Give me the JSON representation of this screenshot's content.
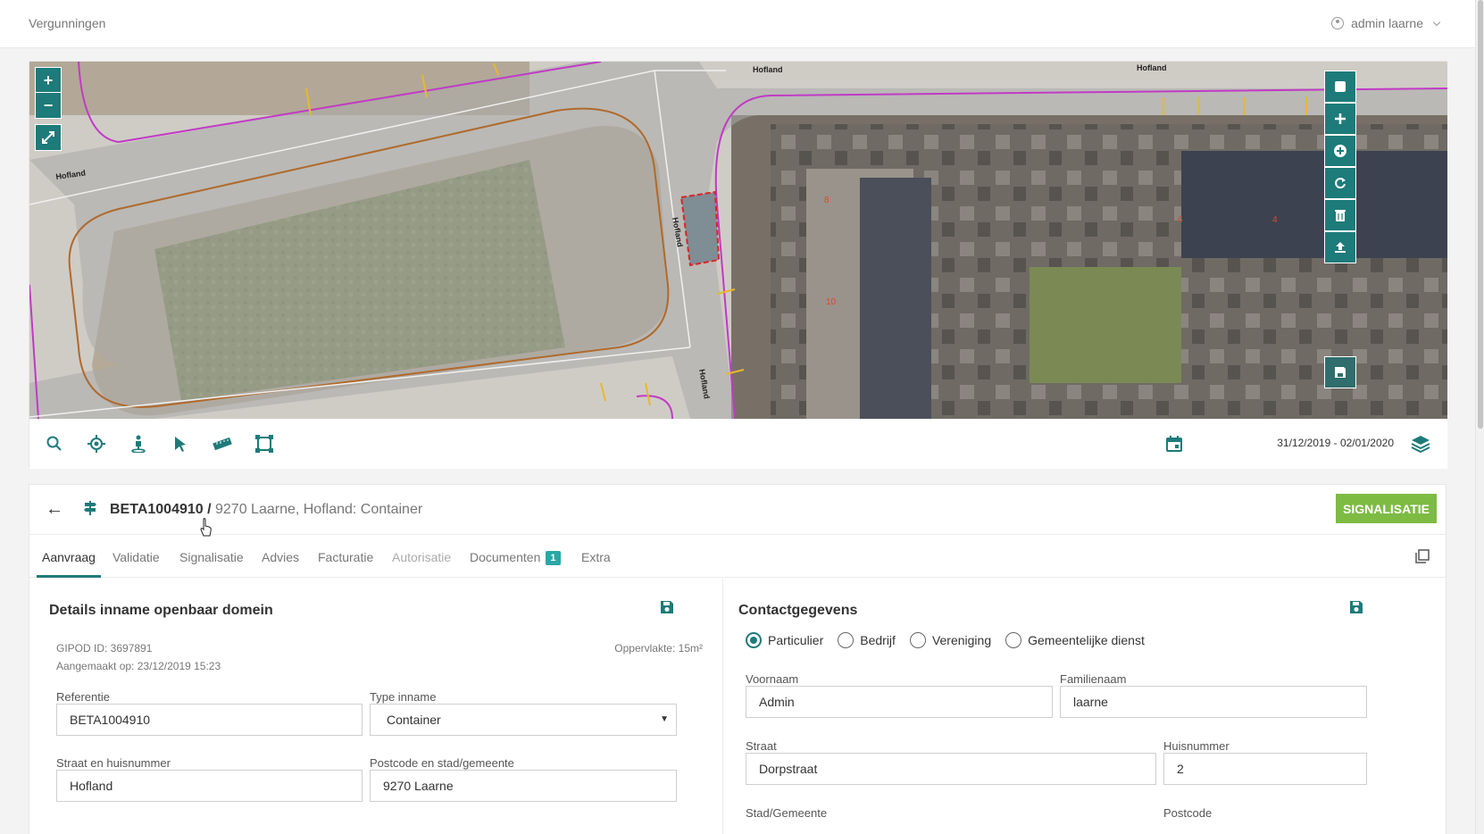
{
  "header": {
    "app_title": "Vergunningen",
    "user_name": "admin laarne"
  },
  "map": {
    "street_labels": [
      "Hofland",
      "Hofland",
      "Hofland",
      "Hofland",
      "Hofland"
    ],
    "house_numbers": [
      "8",
      "10",
      "6",
      "4"
    ],
    "zoom_in": "+",
    "zoom_out": "−",
    "date_range": "31/12/2019 - 02/01/2020"
  },
  "case": {
    "id": "BETA1004910",
    "separator": " / ",
    "address": "9270 Laarne, Hofland: Container",
    "signalisatie_button": "SIGNALISATIE"
  },
  "tabs": [
    {
      "label": "Aanvraag"
    },
    {
      "label": "Validatie"
    },
    {
      "label": "Signalisatie"
    },
    {
      "label": "Advies"
    },
    {
      "label": "Facturatie"
    },
    {
      "label": "Autorisatie"
    },
    {
      "label": "Documenten",
      "badge": "1"
    },
    {
      "label": "Extra"
    }
  ],
  "details": {
    "title": "Details inname openbaar domein",
    "gipod": "GIPOD ID: 3697891",
    "created": "Aangemaakt op: 23/12/2019 15:23",
    "area": "Oppervlakte: 15m²",
    "referentie_label": "Referentie",
    "referentie_value": "BETA1004910",
    "type_label": "Type inname",
    "type_value": "Container",
    "straat_label": "Straat en huisnummer",
    "straat_value": "Hofland",
    "postcode_label": "Postcode en stad/gemeente",
    "postcode_value": "9270 Laarne"
  },
  "contact": {
    "title": "Contactgegevens",
    "radios": [
      "Particulier",
      "Bedrijf",
      "Vereniging",
      "Gemeentelijke dienst"
    ],
    "voornaam_label": "Voornaam",
    "voornaam_value": "Admin",
    "familienaam_label": "Familienaam",
    "familienaam_value": "laarne",
    "straat_label": "Straat",
    "straat_value": "Dorpstraat",
    "huisnummer_label": "Huisnummer",
    "huisnummer_value": "2",
    "stad_label": "Stad/Gemeente",
    "postcode_label": "Postcode"
  },
  "colors": {
    "accent": "#1d7b7a",
    "success": "#7dbb43",
    "badge": "#2aa7a6"
  }
}
